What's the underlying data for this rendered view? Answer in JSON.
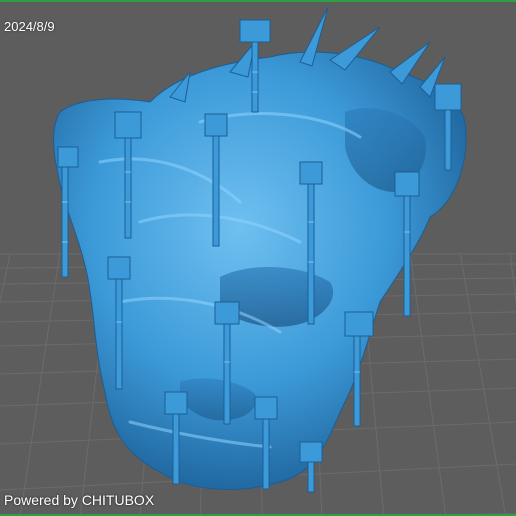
{
  "viewer": {
    "date_stamp": "2024/8/9",
    "watermark": "Powered by CHITUBOX"
  },
  "colors": {
    "background": "#5d5d5d",
    "grid_line": "#6c6c6c",
    "model_base": "#3c9ad8",
    "model_light": "#6fc0f0",
    "model_dark": "#1c5e96",
    "frame_accent": "#2ea043"
  },
  "model": {
    "name_icon": "3d-sculpt-model-with-supports"
  }
}
